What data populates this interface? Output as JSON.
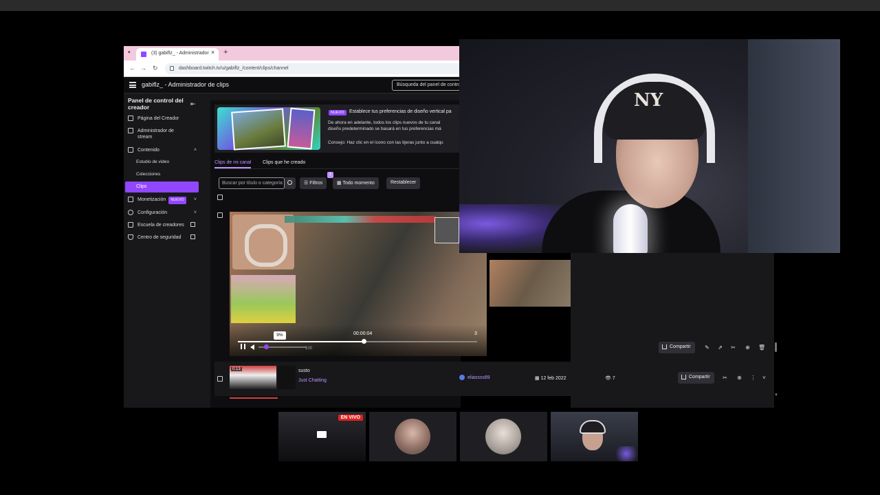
{
  "browser": {
    "tab_title": "(3) gabiflz_ - Administrador",
    "url": "dashboard.twitch.tv/u/gabiflz_/content/clips/channel"
  },
  "app": {
    "title": "gabiflz_ - Administrador de clips",
    "search_placeholder": "Búsqueda del panel de control"
  },
  "sidebar": {
    "title": "Panel de control del creador",
    "items": [
      {
        "label": "Página del Creador"
      },
      {
        "label": "Administrador de stream"
      },
      {
        "label": "Contenido"
      },
      {
        "label": "Estudio de video"
      },
      {
        "label": "Colecciones"
      },
      {
        "label": "Clips"
      },
      {
        "label": "Monetización",
        "badge": "NUEVO"
      },
      {
        "label": "Configuración"
      },
      {
        "label": "Escuela de creadores"
      },
      {
        "label": "Centro de seguridad"
      }
    ]
  },
  "banner": {
    "badge": "NUEVO",
    "heading": "Establece tus preferencias de diseño vertical pa",
    "line1": "De ahora en adelante, todos los clips nuevos de tu canal",
    "line2": "diseño predeterminado se basará en tus preferencias má",
    "tip": "Consejo: Haz clic en el ícono con las tijeras junto a cualqu"
  },
  "tabs": {
    "mine": "Clips de mi canal",
    "created": "Clips que he creado"
  },
  "filters": {
    "search_placeholder": "Buscar por título o categoría",
    "filters_label": "Filtros",
    "filters_count": "1",
    "time_label": "Todo momento",
    "reset_label": "Restablecer"
  },
  "player": {
    "timecode": "00:00:04",
    "end_label": "3",
    "volume_tooltip": "9%",
    "volume_max": "100"
  },
  "actions": {
    "share": "Compartir"
  },
  "clip_row": {
    "duration": "0:13",
    "title": "susto",
    "category": "Just Chatting",
    "creator": "eliassss89",
    "date": "12 feb 2022",
    "views": "7"
  },
  "participants": {
    "live_badge": "EN VIVO"
  },
  "webcam": {
    "cap_logo": "NY"
  }
}
